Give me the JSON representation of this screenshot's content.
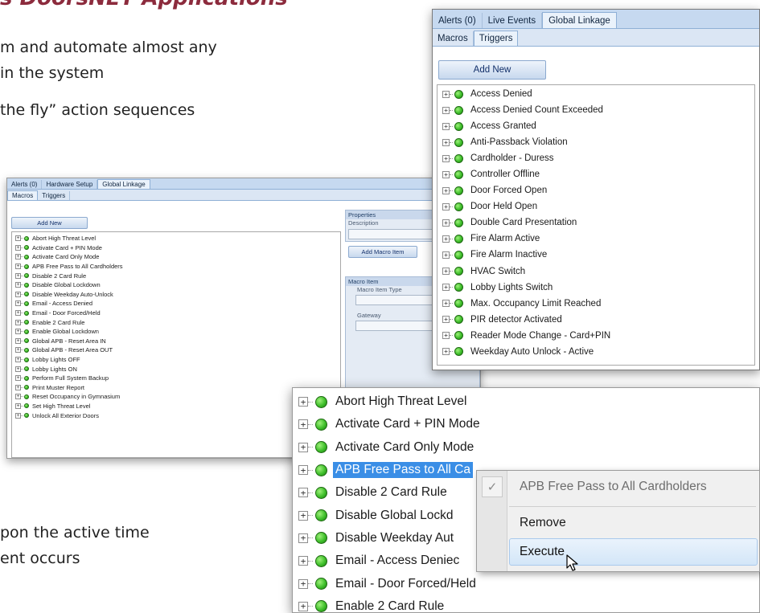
{
  "slide": {
    "heading": "s DoorsNET Applications",
    "line1": "m and automate almost any",
    "line2": "in the system",
    "line3": "the fly” action sequences",
    "line4": "pon the active time",
    "line5": "ent occurs"
  },
  "window_triggers": {
    "tabs": [
      "Alerts (0)",
      "Live Events",
      "Global Linkage"
    ],
    "active_tab": "Global Linkage",
    "subtabs": [
      "Macros",
      "Triggers"
    ],
    "active_subtab": "Triggers",
    "add_button": "Add New",
    "items": [
      "Access Denied",
      "Access Denied Count Exceeded",
      "Access Granted",
      "Anti-Passback Violation",
      "Cardholder - Duress",
      "Controller Offline",
      "Door Forced Open",
      "Door Held Open",
      "Double Card Presentation",
      "Fire Alarm Active",
      "Fire Alarm Inactive",
      "HVAC Switch",
      "Lobby Lights Switch",
      "Max. Occupancy Limit Reached",
      "PIR detector Activated",
      "Reader Mode Change - Card+PIN",
      "Weekday Auto Unlock - Active"
    ]
  },
  "window_macros": {
    "tabs": [
      "Alerts (0)",
      "Hardware Setup",
      "Global Linkage"
    ],
    "active_tab": "Global Linkage",
    "subtabs": [
      "Macros",
      "Triggers"
    ],
    "active_subtab": "Macros",
    "add_button": "Add New",
    "items": [
      "Abort High Threat Level",
      "Activate Card + PIN Mode",
      "Activate Card Only Mode",
      "APB Free Pass to All Cardholders",
      "Disable 2 Card Rule",
      "Disable Global Lockdown",
      "Disable Weekday Auto-Unlock",
      "Email - Access Denied",
      "Email - Door Forced/Held",
      "Enable 2 Card Rule",
      "Enable Global Lockdown",
      "Global APB - Reset Area IN",
      "Global APB - Reset Area OUT",
      "Lobby Lights OFF",
      "Lobby Lights ON",
      "Perform Full System Backup",
      "Print Muster Report",
      "Reset Occupancy in Gymnasium",
      "Set High Threat Level",
      "Unlock All Exterior Doors"
    ],
    "properties": {
      "header": "Properties",
      "description_label": "Description",
      "add_macro_item_button": "Add Macro Item"
    },
    "macro_item": {
      "header": "Macro Item",
      "type_label": "Macro Item Type",
      "gateway_label": "Gateway"
    }
  },
  "window_zoom": {
    "items": [
      "Abort High Threat Level",
      "Activate Card + PIN Mode",
      "Activate Card Only Mode",
      "APB Free Pass to All Ca",
      "Disable 2 Card Rule",
      "Disable Global Lockd",
      "Disable Weekday Aut",
      "Email - Access Deniec",
      "Email - Door Forced/Held",
      "Enable 2 Card Rule"
    ],
    "selected_index": 3
  },
  "context_menu": {
    "header_item": "APB Free Pass to All Cardholders",
    "remove": "Remove",
    "execute": "Execute"
  },
  "icons": {
    "expand": "plus-box-icon",
    "status": "green-status-dot-icon",
    "check": "checkmark-icon",
    "cursor": "mouse-pointer-icon"
  },
  "colors": {
    "heading": "#8c2b3d",
    "tab_bar": "#c6d9f0",
    "status_green": "#3fbf2b",
    "selection": "#3a8ee6"
  }
}
